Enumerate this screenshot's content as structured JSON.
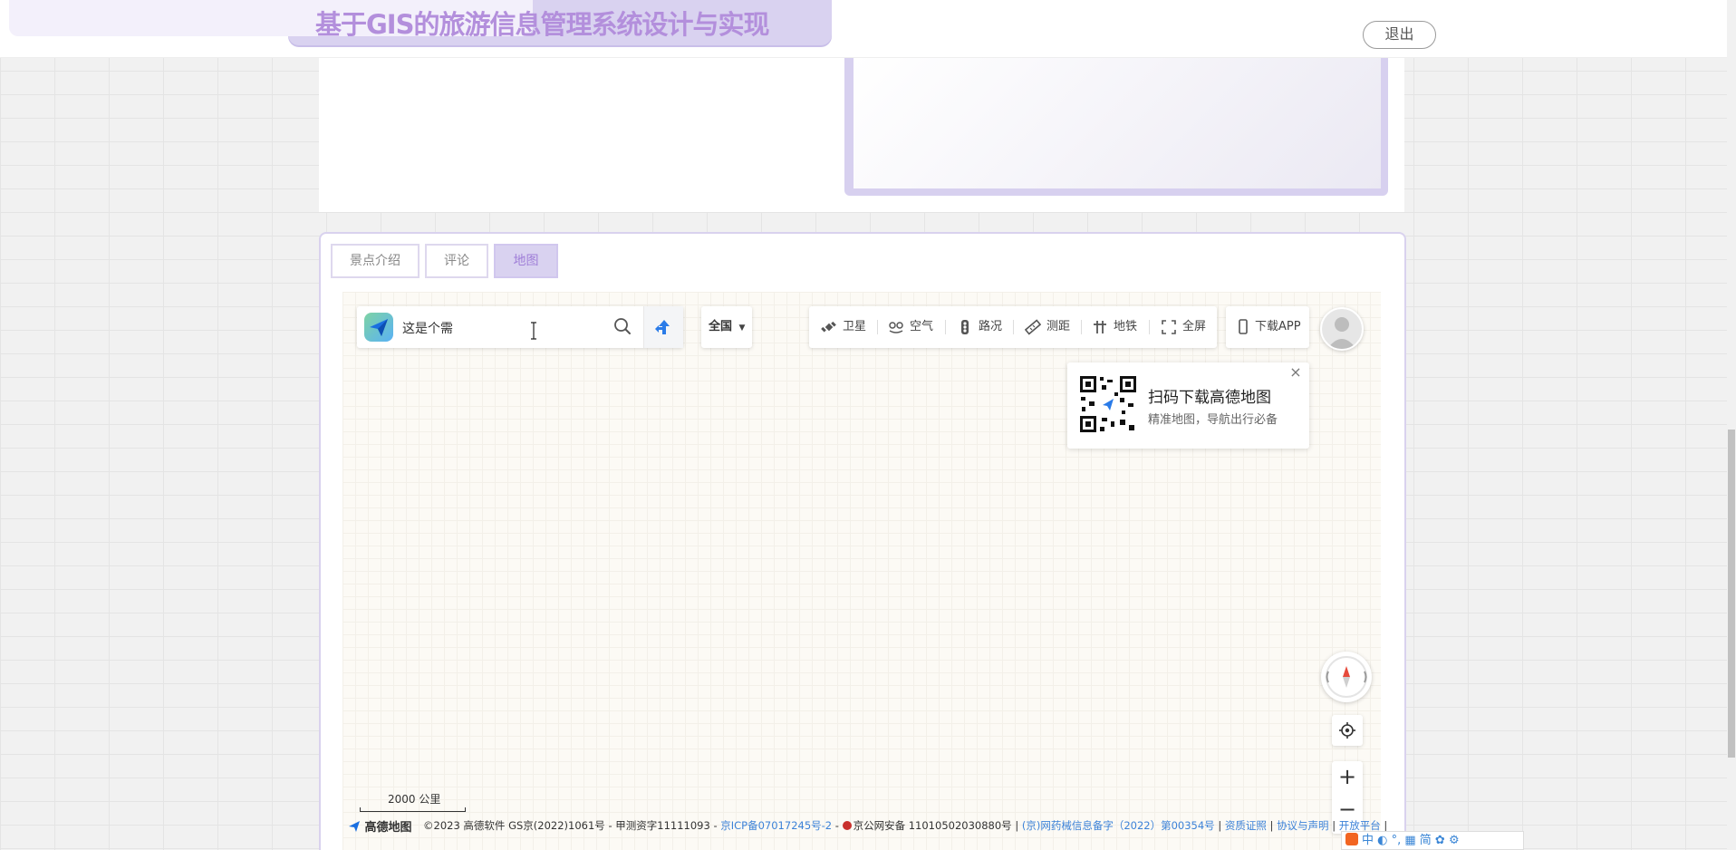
{
  "header": {
    "title": "基于GIS的旅游信息管理系统设计与实现",
    "logout_label": "退出"
  },
  "tabs": [
    {
      "label": "景点介绍",
      "active": false
    },
    {
      "label": "评论",
      "active": false
    },
    {
      "label": "地图",
      "active": true
    }
  ],
  "map": {
    "search": {
      "value": "这是个需"
    },
    "city_select": "全国",
    "toolbar": [
      {
        "label": "卫星",
        "icon": "satellite-icon"
      },
      {
        "label": "空气",
        "icon": "air-icon"
      },
      {
        "label": "路况",
        "icon": "traffic-icon"
      },
      {
        "label": "测距",
        "icon": "ruler-icon"
      },
      {
        "label": "地铁",
        "icon": "subway-icon"
      },
      {
        "label": "全屏",
        "icon": "fullscreen-icon"
      }
    ],
    "download_app": "下载APP",
    "qr_popup": {
      "title": "扫码下载高德地图",
      "subtitle": "精准地图，导航出行必备",
      "close": "×"
    },
    "scale": "2000 公里",
    "footer_logo": "高德地图",
    "footer": {
      "copyright": "©2023 高德软件 GS京(2022)1061号 - 甲测资字11111093 - ",
      "icp": "京ICP备07017245号-2",
      "sep1": " - ",
      "police": "京公网安备 11010502030880号 | ",
      "medical": "(京)网药械信息备字（2022）第00354号",
      "sep2": " | ",
      "license": "资质证照",
      "sep3": " | ",
      "agreement": "协议与声明",
      "sep4": " | ",
      "open_platform": "开放平台",
      "sep5": " |"
    }
  },
  "ime": {
    "text": "中 ◐ °, ▦ 简 ✿ ⚙"
  },
  "colors": {
    "accent": "#b38fdc",
    "tab_active_bg": "#d9d2f0",
    "link": "#3c82d8"
  }
}
